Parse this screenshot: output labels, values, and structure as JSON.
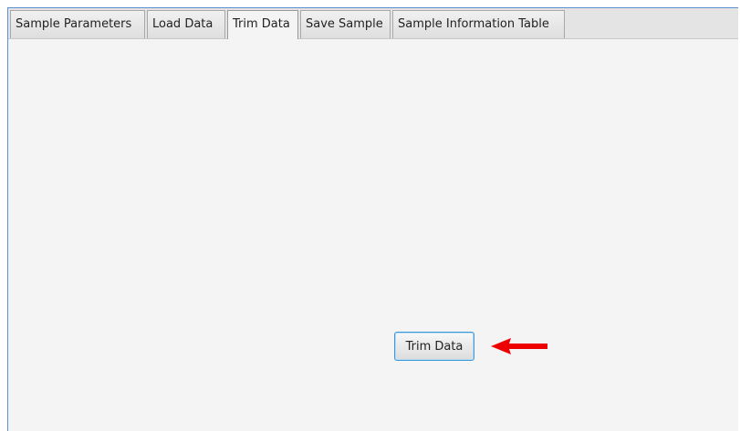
{
  "tabs": [
    {
      "label": "Sample Parameters",
      "active": false
    },
    {
      "label": "Load Data",
      "active": false
    },
    {
      "label": "Trim Data",
      "active": true
    },
    {
      "label": "Save Sample",
      "active": false
    },
    {
      "label": "Sample Information Table",
      "active": false
    }
  ],
  "trim_panel": {
    "button_label": "Trim Data"
  },
  "annotation": {
    "arrow_icon": "red-left-arrow",
    "arrow_color": "#ee0000"
  },
  "colors": {
    "frame_border": "#5b8fd0",
    "button_focus_border": "#3d9ad8"
  }
}
